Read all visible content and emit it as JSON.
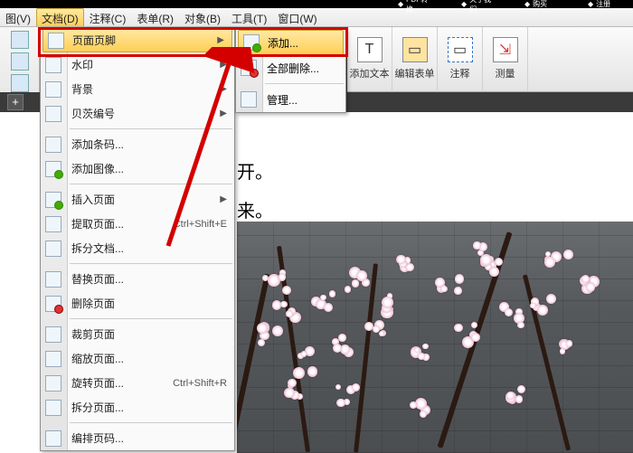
{
  "menubar": {
    "items": [
      "图(V)",
      "文档(D)",
      "注释(C)",
      "表单(R)",
      "对象(B)",
      "工具(T)",
      "窗口(W)"
    ],
    "active_index": 1
  },
  "top_icons": [
    "PDF转换",
    "关于我们",
    "购买",
    "注册"
  ],
  "ribbon": [
    {
      "label": "添加文本"
    },
    {
      "label": "编辑表单"
    },
    {
      "label": "注释"
    },
    {
      "label": "测量"
    }
  ],
  "menu": [
    {
      "icon": "page-hf-icon",
      "label": "页面页脚",
      "arrow": true,
      "sel": true
    },
    {
      "icon": "watermark-icon",
      "label": "水印",
      "arrow": true
    },
    {
      "icon": "background-icon",
      "label": "背景",
      "arrow": true
    },
    {
      "icon": "bates-icon",
      "label": "贝茨编号",
      "arrow": true
    },
    {
      "sep": true
    },
    {
      "icon": "barcode-icon",
      "label": "添加条码..."
    },
    {
      "icon": "image-icon",
      "label": "添加图像...",
      "iconGreen": true
    },
    {
      "sep": true
    },
    {
      "icon": "insert-page-icon",
      "label": "插入页面",
      "arrow": true,
      "iconGreen": true
    },
    {
      "icon": "extract-page-icon",
      "label": "提取页面...",
      "shortcut": "Ctrl+Shift+E"
    },
    {
      "icon": "split-doc-icon",
      "label": "拆分文档..."
    },
    {
      "sep": true
    },
    {
      "icon": "replace-page-icon",
      "label": "替换页面..."
    },
    {
      "icon": "delete-page-icon",
      "label": "删除页面",
      "iconRed": true
    },
    {
      "sep": true
    },
    {
      "icon": "crop-page-icon",
      "label": "裁剪页面"
    },
    {
      "icon": "zoom-page-icon",
      "label": "缩放页面..."
    },
    {
      "icon": "rotate-page-icon",
      "label": "旋转页面...",
      "shortcut": "Ctrl+Shift+R"
    },
    {
      "icon": "split-page-icon",
      "label": "拆分页面..."
    },
    {
      "sep": true
    },
    {
      "icon": "page-number-icon",
      "label": "编排页码..."
    }
  ],
  "submenu": [
    {
      "icon": "add-icon",
      "label": "添加...",
      "sel": true,
      "iconGreen": true
    },
    {
      "icon": "delete-all-icon",
      "label": "全部删除...",
      "iconRed": true
    },
    {
      "sep": true
    },
    {
      "icon": "manage-icon",
      "label": "管理..."
    }
  ],
  "content": {
    "line1": "开。",
    "line2": "来。"
  },
  "plus_tab": "+"
}
